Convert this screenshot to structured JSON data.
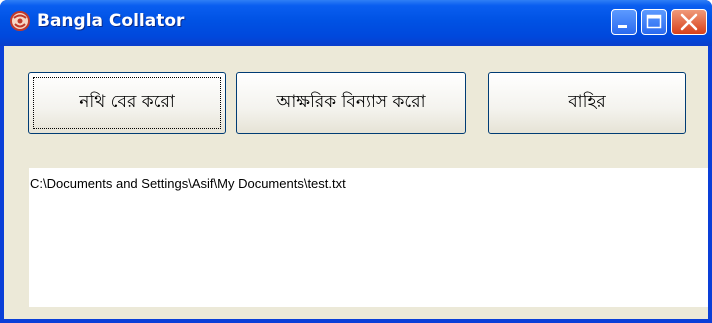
{
  "window": {
    "title": "Bangla Collator",
    "icons": {
      "app": "app-logo-icon",
      "minimize": "minimize-icon",
      "maximize": "maximize-icon",
      "close": "close-icon"
    },
    "colors": {
      "titlebar": "#0052e4",
      "client": "#ece9d8",
      "close_button": "#d8401a"
    }
  },
  "buttons": {
    "open_file": "নথি বের করো",
    "sort": "আক্ষরিক বিন্যাস করো",
    "exit": "বাহির"
  },
  "output": {
    "text": "C:\\Documents and Settings\\Asif\\My Documents\\test.txt"
  }
}
